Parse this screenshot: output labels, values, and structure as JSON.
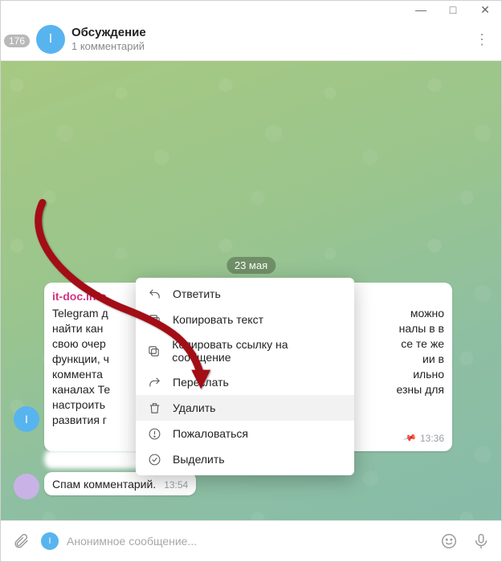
{
  "window": {
    "min": "—",
    "max": "□",
    "close": "✕"
  },
  "header": {
    "back_count": "176",
    "avatar_letter": "I",
    "title": "Обсуждение",
    "subtitle": "1 комментарий"
  },
  "chat": {
    "date_label": "23 мая",
    "msg1": {
      "sender": "it-doc.info",
      "line1": "Telegram д",
      "line2": "найти кан",
      "line3": "свою очер",
      "line4": "функции, ч",
      "line5": "коммента",
      "line6": "каналах Те",
      "line7": "настроить",
      "line8": "развития г",
      "right1": "можно",
      "right2": "налы в в",
      "right3": "се те же",
      "right4": "",
      "right5": "ии в",
      "right6": "ильно",
      "right7": "езны для",
      "right8": "",
      "time": "13:36"
    },
    "msg2": {
      "text": "Спам комментарий.",
      "time": "13:54"
    }
  },
  "context_menu": {
    "items": [
      {
        "id": "reply",
        "label": "Ответить"
      },
      {
        "id": "copytext",
        "label": "Копировать текст"
      },
      {
        "id": "copylink",
        "label": "Копировать ссылку на сообщение"
      },
      {
        "id": "forward",
        "label": "Переслать"
      },
      {
        "id": "delete",
        "label": "Удалить"
      },
      {
        "id": "report",
        "label": "Пожаловаться"
      },
      {
        "id": "select",
        "label": "Выделить"
      }
    ]
  },
  "composer": {
    "avatar_letter": "I",
    "placeholder": "Анонимное сообщение..."
  }
}
